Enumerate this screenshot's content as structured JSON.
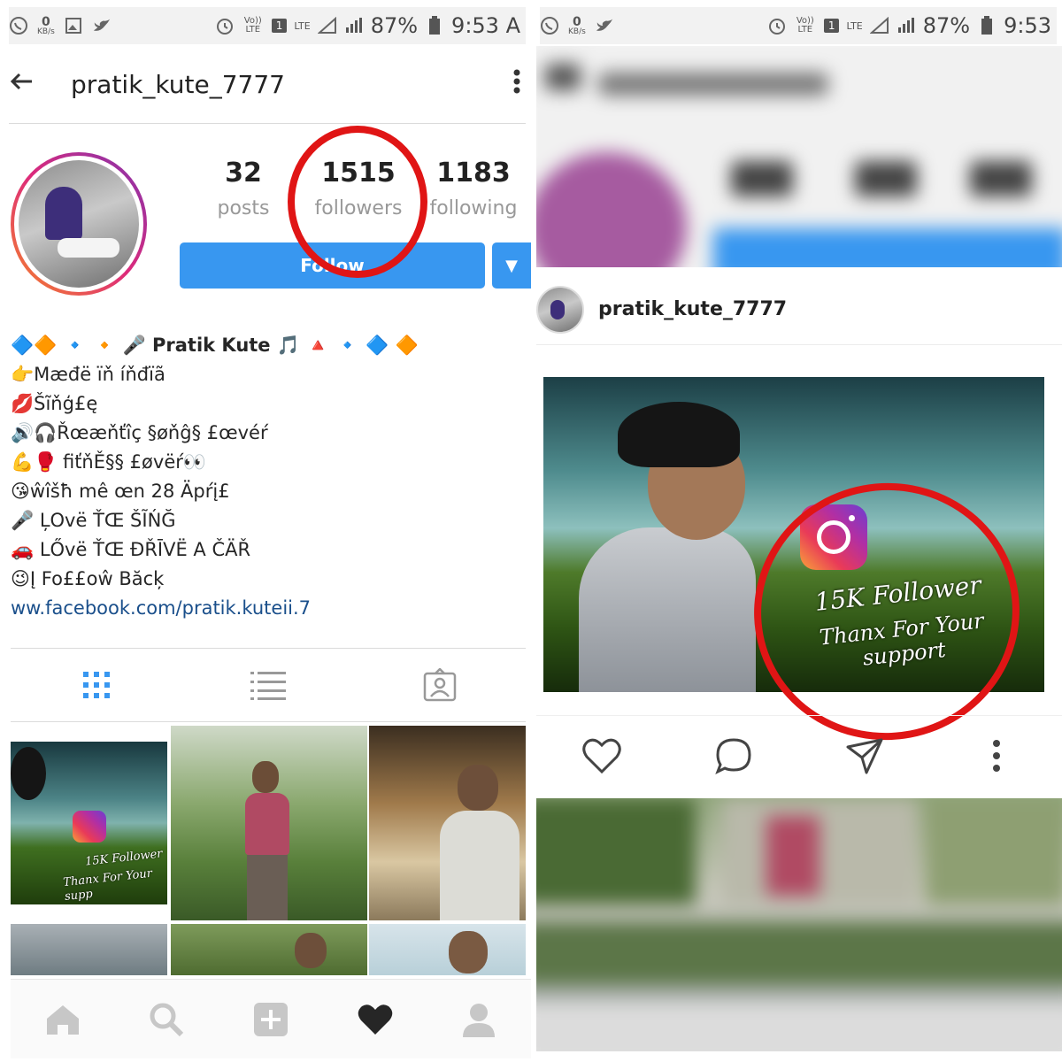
{
  "status_bar": {
    "speed_value": "0",
    "speed_unit": "KB/s",
    "network_volte": "Vo)) LTE",
    "sim": "1",
    "network_lte": "LTE",
    "battery": "87%",
    "time_left": "9:53 A",
    "time_right": "9:53"
  },
  "profile": {
    "username": "pratik_kute_7777",
    "stats": [
      {
        "value": "32",
        "label": "posts"
      },
      {
        "value": "1515",
        "label": "followers"
      },
      {
        "value": "1183",
        "label": "following"
      }
    ],
    "follow_label": "Follow",
    "bio": [
      "🔷🔶 🔹 🔸 🎤 Pratik Kute 🎵 🔺 🔹 🔷 🔶",
      "👉Mæđë ïň íňđïã",
      "💋Šĩňģ£ę",
      "🔊🎧Řœæňťîç §øňĝ§ £œvéŕ",
      "💪🥊 fiťňĚ§§ £øvëŕ👀",
      "😘ŵîšħ mê œn 28 Äpŕį£",
      "🎤 ĻOvë ŤŒ ŠĨŃĞ",
      "🚗 LŐvë ŤŒ ĐŘĪVË A ČÄŘ",
      "😉Į Fo££oŵ Băcķ",
      "ww.facebook.com/pratik.kuteii.7"
    ]
  },
  "grid_thumbs": {
    "first_caption_l1": "15K Follower",
    "first_caption_l2": "Thanx For Your supp"
  },
  "post": {
    "username": "pratik_kute_7777",
    "caption_l1": "15K Follower",
    "caption_l2": "Thanx For Your support"
  },
  "colors": {
    "accent_blue": "#3897f0",
    "highlight_red": "#e01515",
    "text": "#262626",
    "muted": "#999999"
  }
}
